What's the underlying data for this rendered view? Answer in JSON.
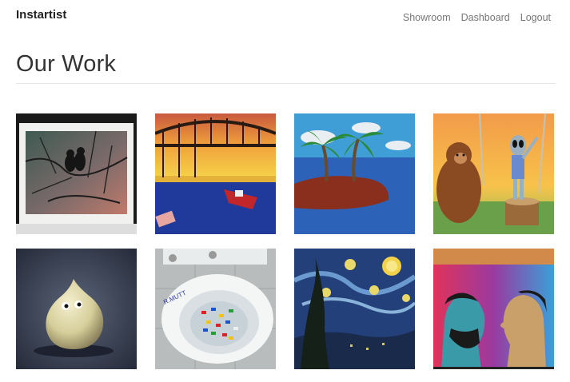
{
  "nav": {
    "brand": "Instartist",
    "links": [
      "Showroom",
      "Dashboard",
      "Logout"
    ]
  },
  "main": {
    "title": "Our Work"
  },
  "gallery": {
    "items": [
      {
        "subject": "birds-on-branch-painting-icon"
      },
      {
        "subject": "bridge-sunset-boat-painting-icon"
      },
      {
        "subject": "palm-island-painting-icon"
      },
      {
        "subject": "bigfoot-alien-painting-icon"
      },
      {
        "subject": "onion-creature-painting-icon"
      },
      {
        "subject": "lego-toilet-photo-icon"
      },
      {
        "subject": "starry-night-painting-icon"
      },
      {
        "subject": "two-faces-painting-icon"
      }
    ]
  }
}
